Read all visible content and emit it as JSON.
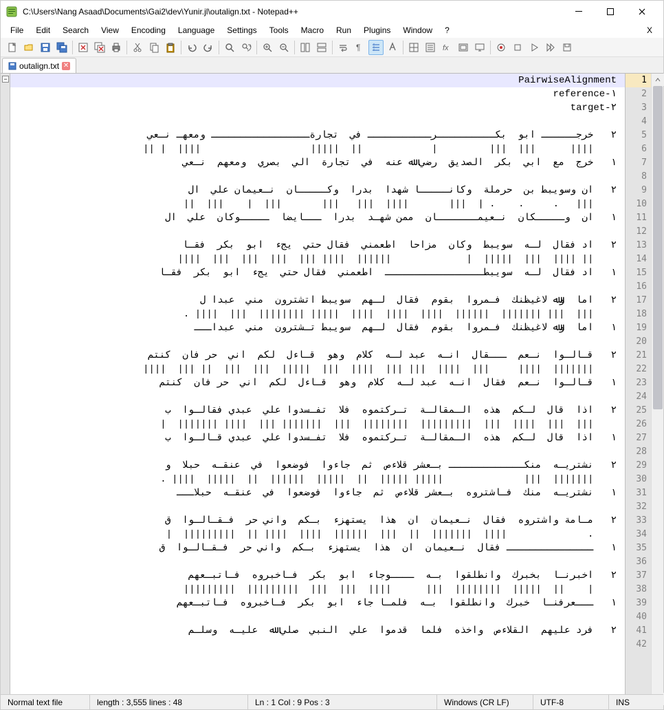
{
  "window": {
    "title": "C:\\Users\\Nang Asaad\\Documents\\Gai2\\dev\\Yunir.jl\\outalign.txt - Notepad++"
  },
  "menu": {
    "items": [
      "File",
      "Edit",
      "Search",
      "View",
      "Encoding",
      "Language",
      "Settings",
      "Tools",
      "Macro",
      "Run",
      "Plugins",
      "Window",
      "?"
    ],
    "trail": "X"
  },
  "tab": {
    "name": "outalign.txt"
  },
  "lines": [
    {
      "n": 1,
      "current": true,
      "rtl": false,
      "t": "PairwiseAlignment"
    },
    {
      "n": 2,
      "rtl": false,
      "t": "reference-١"
    },
    {
      "n": 3,
      "rtl": false,
      "t": "target-٢"
    },
    {
      "n": 4,
      "t": ""
    },
    {
      "n": 5,
      "t": "٢   خرجــــــ ابو  بكــــــــــرـــــــــــ في  تجارةـــــــــــــــــ ومعهـ نـعي"
    },
    {
      "n": 6,
      "t": "    ||||      |||  |||         |            ||  |||||                   ||||  | ||"
    },
    {
      "n": 7,
      "t": "١   خرج  مع  ابي  بكر  الصديق  رضي ﷲ عنه  في  تجارة  الي  بصري  ومعهم  نـعي"
    },
    {
      "n": 8,
      "t": ""
    },
    {
      "n": 9,
      "t": "٢   ان وسويبط بن  حرملة  وكانـــــا شهدا  بدرا  وكـــــان  نـعيمان علي  ال"
    },
    {
      "n": 10,
      "t": "    |||   .     .    . |  |||       ||||  |||   |||       |||  |    |||  ||"
    },
    {
      "n": 11,
      "t": "١   ان  وـــــكان  نـعيمـــــــان  ممن شهـد  بدرا  ـــايضا  ـــــوكان  علي  ال"
    },
    {
      "n": 12,
      "t": ""
    },
    {
      "n": 13,
      "t": "٢   اد فقال  لـه  سويبط  وكان  مزاحا  اطعمني  فقال حتي  يجء  ابو  بكر  فقـا"
    },
    {
      "n": 14,
      "t": "    || ||||  |||  |||||  |             ||||||  |||| |||  |||  |||  |||  ||||"
    },
    {
      "n": 15,
      "t": "١   اد فقال  لـه  سويبطـــــــــــــــــ  اطعمني  فقال حتي  يجء  ابو  بكر  فقـا"
    },
    {
      "n": 16,
      "t": ""
    },
    {
      "n": 17,
      "t": "٢   اما  وﷲ لاغيظنك  فـمروا  بقوم  فقال  لـهم  سويبط اتشترون  مني  عبدا ل"
    },
    {
      "n": 18,
      "t": "    |||  ||| |||||||  ||||||  ||||  ||||  ||||  ||||| ||||||||  |||  |||| ."
    },
    {
      "n": 19,
      "t": "١   اما  وﷲ لاغيظنك  فـمروا  بقوم  فقال  لـهم  سويبط تـشترون  مني  عبداـــ"
    },
    {
      "n": 20,
      "t": ""
    },
    {
      "n": 21,
      "t": "٢   قـالـوا  نـعم  ـــقال  انـه  عبد لـه  كلام  وهو  قـاءل  لكم  اني  حر فان  كنتم"
    },
    {
      "n": 22,
      "t": "    |||||||  ||||     |||  ||||  ||| |||  ||||  |||  |||||  |||  |||  || |||  ||||"
    },
    {
      "n": 23,
      "t": "١   قـالـوا  نـعم  فقال  انـه  عبد لـه  كلام  وهو  قـاءل  لكم  اني  حر فان  كنتم"
    },
    {
      "n": 24,
      "t": ""
    },
    {
      "n": 25,
      "t": "٢   اذا  قال  لـكم  هذه  الـمقالـة  تـركتموه  فلا  تفـسدوا علي  عبدي فقالـوا  ب"
    },
    {
      "n": 26,
      "t": "    |||  |||  ||||  |||  |||||||||  ||||||||  |||  ||||||| |||  |||| |||||||  |"
    },
    {
      "n": 27,
      "t": "١   اذا  قال  لـكم  هذه  الـمقالـة  تـركتموه  فلا  تفـسدوا علي  عبدي قـالـوا  ب"
    },
    {
      "n": 28,
      "t": ""
    },
    {
      "n": 29,
      "t": "٢   نشتريـه  منكـــــــــــــ بـعشر قلاءص  ثم  جاءوا  فوضعوا  في  عنقـه  حبلا  و"
    },
    {
      "n": 30,
      "t": "    |||||||  |||              ||||| |||||  ||  |||||  ||||||  ||  |||||  |||| ."
    },
    {
      "n": 31,
      "t": "١   نشتريـه  منك  فـاشتروه  بـعشر قلاءص  ثم  جاءوا  فوضعوا  في  عنقـه  حبلاـــ"
    },
    {
      "n": 32,
      "t": ""
    },
    {
      "n": 33,
      "t": "٢   مـامة واشتروه  فقال  نـعيمان  ان  هذا  يستهزء  بـكم  واني حر  فـقـالـوا  ق"
    },
    {
      "n": 34,
      "t": "    .              ||||  |||||||  ||  |||  ||||||  ||||  |||| ||  |||||||||  |"
    },
    {
      "n": 35,
      "t": "١   ـــــــــــــــ فقال  نـعيمان  ان  هذا  يستهزء  بـكم  واني حر  فـقـالـوا  ق"
    },
    {
      "n": 36,
      "t": ""
    },
    {
      "n": 37,
      "t": "٢   اخبرنـا  بخبرك  وانطلقوا  بـه  ــــوجاء  ابو  بكر  فـاخبروه  فـاتبـعهم"
    },
    {
      "n": 38,
      "t": "    |    ||  |||||  ||||||||  |||      ||||  |||  |||  |||||||||  |||||||||"
    },
    {
      "n": 39,
      "t": "١   ـــعرفنـا  خبرك  وانطلقوا  بـه  فلمـا جاء  ابو  بكر  فـاخبروه  فـاتبـعهم"
    },
    {
      "n": 40,
      "t": ""
    },
    {
      "n": 41,
      "t": "٢   فرد عليهم  القلاءص  واخذه  فلما  قدموا  علي  النبي  صلي ﷲ  عليـه  وسلـم"
    },
    {
      "n": 42,
      "t": ""
    }
  ],
  "status": {
    "filetype": "Normal text file",
    "length": "length : 3,555    lines : 48",
    "pos": "Ln : 1    Col : 9    Pos : 3",
    "eol": "Windows (CR LF)",
    "encoding": "UTF-8",
    "ins": "INS"
  }
}
